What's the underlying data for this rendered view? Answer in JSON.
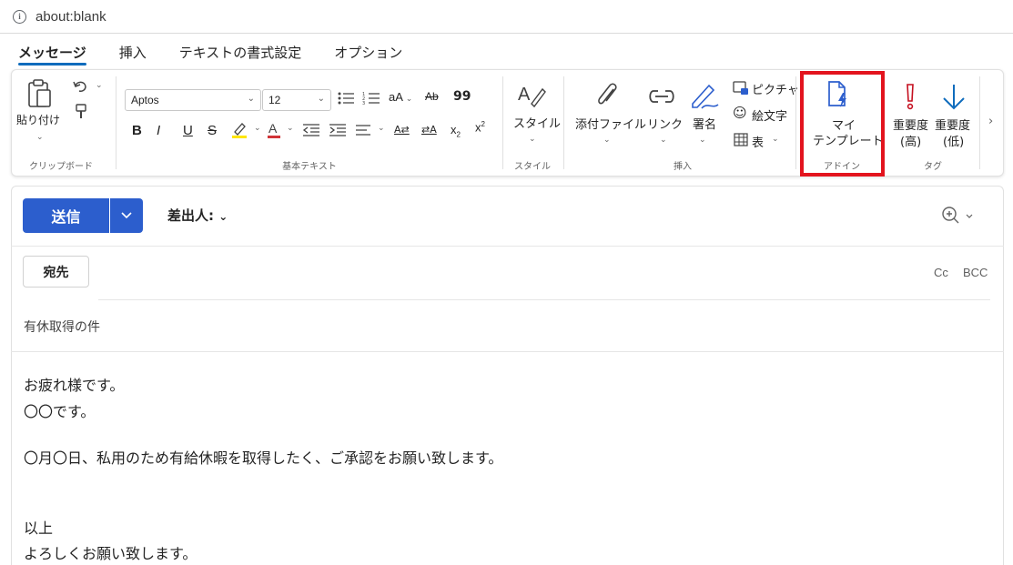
{
  "browser": {
    "url": "about:blank"
  },
  "tabs": [
    "メッセージ",
    "挿入",
    "テキストの書式設定",
    "オプション"
  ],
  "ribbon": {
    "clipboard": {
      "paste_label": "貼り付け",
      "group": "クリップボード"
    },
    "basic_text": {
      "font": "Aptos",
      "size": "12",
      "group": "基本テキスト",
      "format_buttons": [
        "B",
        "I",
        "U",
        "S"
      ]
    },
    "style": {
      "label": "スタイル",
      "group": "スタイル"
    },
    "insert": {
      "attach_label": "添付ファイル",
      "link_label": "リンク",
      "signature_label": "署名",
      "picture_label": "ピクチャ",
      "emoji_label": "絵文字",
      "table_label": "表",
      "group": "挿入"
    },
    "addin": {
      "label_line1": "マイ",
      "label_line2": "テンプレート",
      "group": "アドイン"
    },
    "tags": {
      "high_line1": "重要度",
      "high_line2": "(高)",
      "low_line1": "重要度",
      "low_line2": "(低)",
      "group": "タグ"
    }
  },
  "compose": {
    "send_label": "送信",
    "from_label": "差出人:",
    "to_label": "宛先",
    "cc_label": "Cc",
    "bcc_label": "BCC",
    "subject": "有休取得の件",
    "body": [
      "お疲れ様です。",
      "〇〇です。",
      "〇月〇日、私用のため有給休暇を取得したく、ご承認をお願い致します。",
      "以上",
      "よろしくお願い致します。"
    ]
  },
  "colors": {
    "accent": "#0f6cbd",
    "send": "#2c5ecd",
    "highlight": "#e3141e",
    "importance_high": "#c50f1f",
    "importance_low": "#0f6cbd"
  }
}
